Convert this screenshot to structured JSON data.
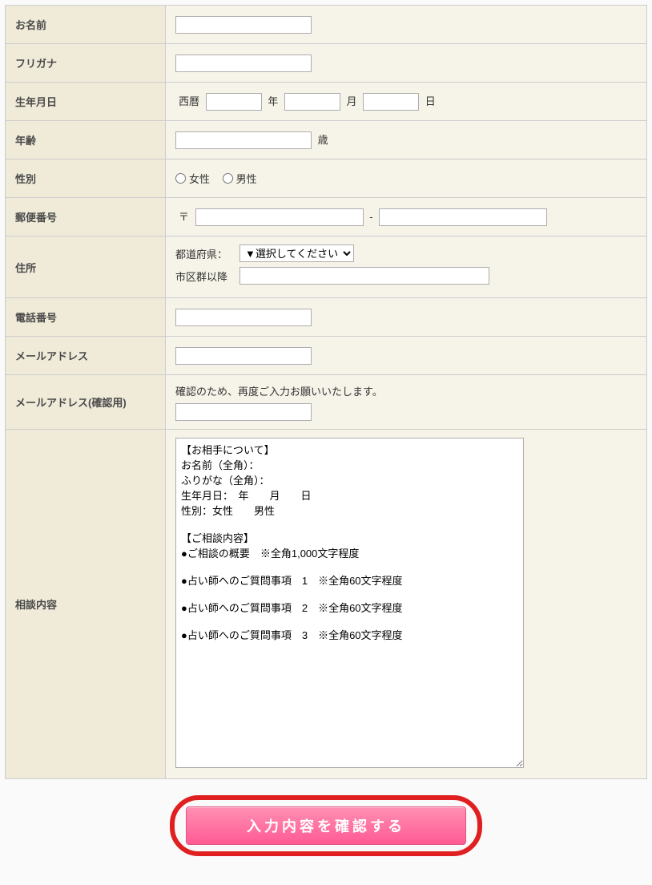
{
  "labels": {
    "name": "お名前",
    "furigana": "フリガナ",
    "birthdate": "生年月日",
    "age": "年齢",
    "sex": "性別",
    "postal": "郵便番号",
    "address": "住所",
    "phone": "電話番号",
    "email": "メールアドレス",
    "email_confirm": "メールアドレス(確認用)",
    "consult": "相談内容"
  },
  "birthdate": {
    "era": "西曆",
    "year_suffix": "年",
    "month_suffix": "月",
    "day_suffix": "日"
  },
  "age": {
    "suffix": "歳"
  },
  "sex": {
    "female": "女性",
    "male": "男性"
  },
  "postal": {
    "prefix": "〒",
    "dash": "-"
  },
  "address": {
    "prefecture_label": "都道府県：",
    "city_label": "市区群以降",
    "select_placeholder": "▼選択してください"
  },
  "email_confirm_note": "確認のため、再度ご入力お願いいたします。",
  "consult_template": "【お相手について】\nお名前（全角）：\nふりがな（全角）：\n生年月日：　年　　月　　日\n性別：女性　　男性\n\n【ご相談内容】\n●ご相談の概要　※全角1,000文字程度\n\n●占い師へのご質問事項　1　※全角60文字程度\n\n●占い師へのご質問事項　2　※全角60文字程度\n\n●占い師へのご質問事項　3　※全角60文字程度\n",
  "submit": "入力内容を確認する"
}
